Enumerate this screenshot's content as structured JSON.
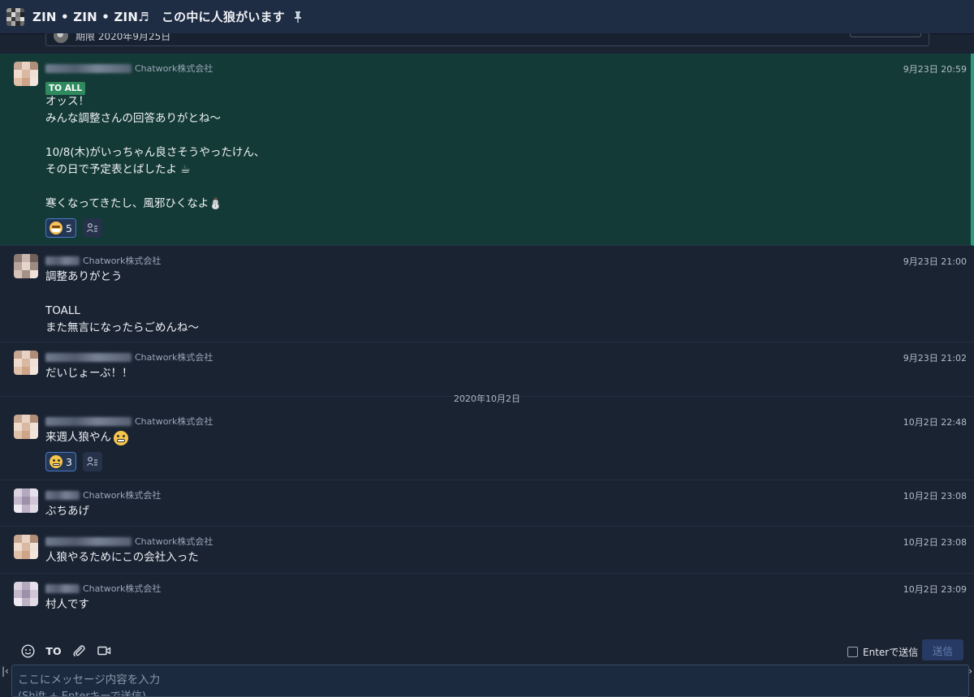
{
  "header": {
    "room_title": "ZIN • ZIN • ZIN♬　この中に人狼がいます",
    "pin_icon": "pin-icon"
  },
  "task": {
    "deadline": "期限 2020年9月25日"
  },
  "messages": [
    {
      "org": "Chatwork株式会社",
      "time": "9月23日 20:59",
      "badge": "TO ALL",
      "lines": "オッス！\nみんな調整さんの回答ありがとね〜\n\n10/8(木)がいっちゃん良さそうやったけん、\nその日で予定表とばしたよ ☕\n\n寒くなってきたし、風邪ひくなよ⛄",
      "reaction_count": "5"
    },
    {
      "org": "Chatwork株式会社",
      "time": "9月23日 21:00",
      "lines": "調整ありがとう\n\nTOALL\nまた無言になったらごめんね〜"
    },
    {
      "org": "Chatwork株式会社",
      "time": "9月23日 21:02",
      "lines": "だいじょーぶ！！"
    },
    {
      "org": "Chatwork株式会社",
      "time": "10月2日 22:48",
      "lines": "来週人狼やん",
      "reaction_count": "3"
    },
    {
      "org": "Chatwork株式会社",
      "time": "10月2日 23:08",
      "lines": "ぶちあげ"
    },
    {
      "org": "Chatwork株式会社",
      "time": "10月2日 23:08",
      "lines": "人狼やるためにこの会社入った"
    },
    {
      "org": "Chatwork株式会社",
      "time": "10月2日 23:09",
      "lines": "村人です"
    }
  ],
  "date_separator": "2020年10月2日",
  "composer": {
    "to_label": "TO",
    "enter_send_label": "Enterで送信",
    "send_label": "送信",
    "placeholder_line1": "ここにメッセージ内容を入力",
    "placeholder_line2": "(Shift + Enterキーで送信)"
  },
  "colors": {
    "background": "#1a2332",
    "highlight": "#143a37",
    "toall_badge": "#2f8a5f",
    "send_button": "#263a63"
  }
}
